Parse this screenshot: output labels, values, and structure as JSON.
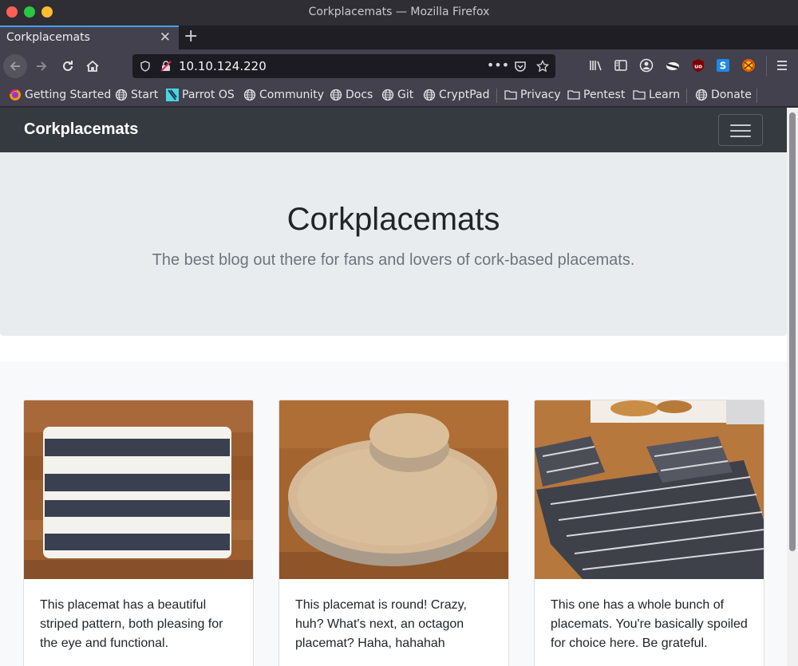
{
  "browser": {
    "window_title": "Corkplacemats — Mozilla Firefox",
    "tab_title": "Corkplacemats",
    "url": "10.10.124.220",
    "bookmarks": [
      "Getting Started",
      "Start",
      "Parrot OS",
      "Community",
      "Docs",
      "Git",
      "CryptPad",
      "Privacy",
      "Pentest",
      "Learn",
      "Donate"
    ],
    "accent_color": "#45a1ff"
  },
  "site": {
    "brand": "Corkplacemats",
    "navbar_color": "#343a40",
    "jumbotron": {
      "title": "Corkplacemats",
      "lead": "The best blog out there for fans and lovers of cork-based placemats."
    },
    "cards": [
      {
        "image": "striped placemat on wooden table",
        "text": "This placemat has a beautiful striped pattern, both pleasing for the eye and functional."
      },
      {
        "image": "stack of round cork placemats",
        "text": "This placemat is round! Crazy, huh? What's next, an octagon placemat? Haha, hahahah"
      },
      {
        "image": "patterned placemats and coasters set",
        "text": "This one has a whole bunch of placemats. You're basically spoiled for choice here. Be grateful."
      }
    ]
  }
}
